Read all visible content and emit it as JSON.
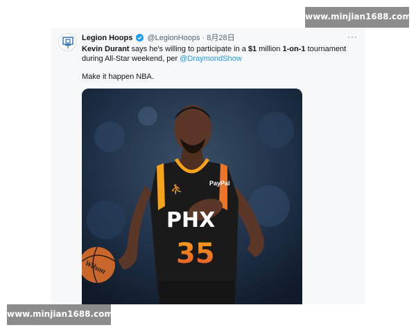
{
  "tweet": {
    "author_name": "Legion Hoops",
    "author_handle": "@LegionHoops",
    "separator": "·",
    "date": "8月28日",
    "more_icon": "more-dots-icon",
    "verified_icon": "verified-badge-icon",
    "text_part1_bold": "Kevin Durant",
    "text_part2": " says he's willing to participate in a ",
    "text_part3_bold": "$1",
    "text_part4": " million ",
    "text_part5_bold": "1-on-1",
    "text_part6": " tournament during All-Star weekend, per ",
    "mention": "@DraymondShow",
    "comment": "Make it happen NBA.",
    "jersey_text": "PHX",
    "jersey_number": "35",
    "sponsor": "PayPal",
    "ball_brand": "Wilson",
    "accent_color": "#1d9bf0"
  },
  "watermarks": {
    "top": "www.minjian1688.com",
    "bottom": "www.minjian1688.com"
  }
}
